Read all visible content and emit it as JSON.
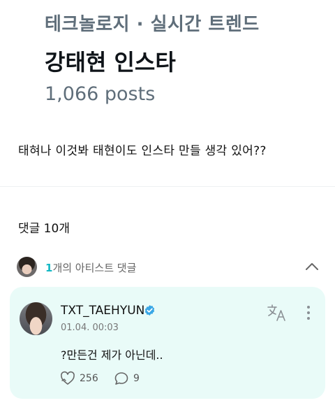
{
  "trend": {
    "category": "테크놀로지 · 실시간 트렌드",
    "title": "강태현 인스타",
    "posts": "1,066 posts"
  },
  "post": {
    "text": "태혀나 이것봐 태현이도 인스타 만들 생각 있어??"
  },
  "comments": {
    "header": "댓글 10개",
    "artist_count": "1",
    "artist_label": "개의 아티스트 댓글",
    "collapse_icon": "chevron-up-icon"
  },
  "comment": {
    "username": "TXT_TAEHYUN",
    "verified_icon": "verified-badge-icon",
    "timestamp": "01.04. 00:03",
    "text": "?만든건 제가 아닌데..",
    "likes": "256",
    "replies": "9",
    "colors": {
      "card_bg": "#e9fbf8",
      "accent": "#14b8c4",
      "verified": "#3aa7e6"
    }
  }
}
